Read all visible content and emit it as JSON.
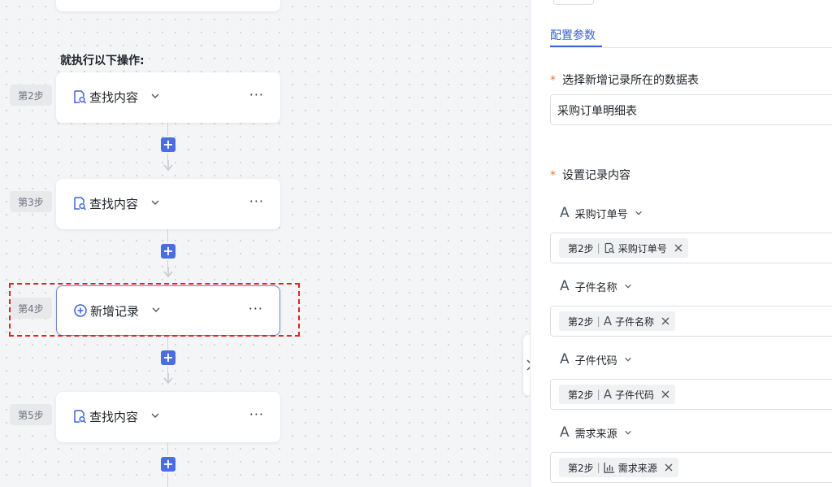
{
  "canvas": {
    "exec_heading": "就执行以下操作:",
    "steps": [
      {
        "badge": "第2步",
        "label": "查找内容",
        "icon": "find-doc-icon"
      },
      {
        "badge": "第3步",
        "label": "查找内容",
        "icon": "find-doc-icon"
      },
      {
        "badge": "第4步",
        "label": "新增记录",
        "icon": "add-circle-icon"
      },
      {
        "badge": "第5步",
        "label": "查找内容",
        "icon": "find-doc-icon"
      }
    ],
    "more": "···",
    "plus": "+"
  },
  "panel": {
    "tab": "配置参数",
    "table_label": "选择新增记录所在的数据表",
    "table_value": "采购订单明细表",
    "content_label": "设置记录内容",
    "required_mark": "*",
    "fields": [
      {
        "title": "采购订单号",
        "tag_step": "第2步",
        "tag_icon": "find-doc-icon",
        "tag_text": "采购订单号"
      },
      {
        "title": "子件名称",
        "tag_step": "第2步",
        "tag_icon": "text-icon",
        "tag_text": "子件名称"
      },
      {
        "title": "子件代码",
        "tag_step": "第2步",
        "tag_icon": "text-icon",
        "tag_text": "子件代码"
      },
      {
        "title": "需求来源",
        "tag_step": "第2步",
        "tag_icon": "bar-chart-icon",
        "tag_text": "需求来源"
      }
    ],
    "field_type_glyph": "A",
    "tag_separator": "|"
  },
  "colors": {
    "accent": "#3a62d7",
    "plus_button": "#4a6ee0",
    "required": "#e07b39",
    "selection": "#e02424"
  }
}
